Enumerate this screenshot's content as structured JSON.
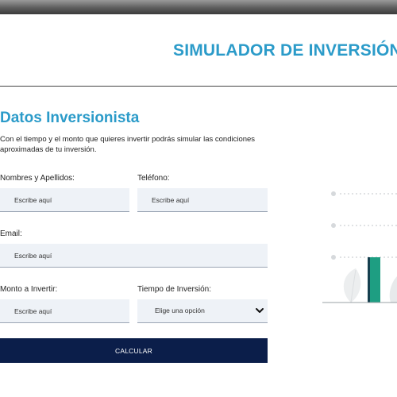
{
  "header": {
    "title": "SIMULADOR DE INVERSIÓN"
  },
  "form": {
    "section_title": "Datos Inversionista",
    "description": "Con el tiempo y el monto que quieres invertir podrás simular las condiciones aproximadas de tu inversión.",
    "fields": {
      "name": {
        "label": "Nombres y Apellidos:",
        "placeholder": "Escribe aquí"
      },
      "phone": {
        "label": "Teléfono:",
        "placeholder": "Escribe aquí"
      },
      "email": {
        "label": "Email:",
        "placeholder": "Escribe aquí"
      },
      "amount": {
        "label": "Monto a Invertir:",
        "placeholder": "Escribe aquí"
      },
      "term": {
        "label": "Tiempo de Inversión:",
        "selected": "Elige una opción"
      }
    },
    "submit_label": "CALCULAR"
  },
  "illustration": {
    "icon": "investment-chart-illustration",
    "bar_color": "#1e9e82",
    "line_color": "#cfd3d6"
  }
}
